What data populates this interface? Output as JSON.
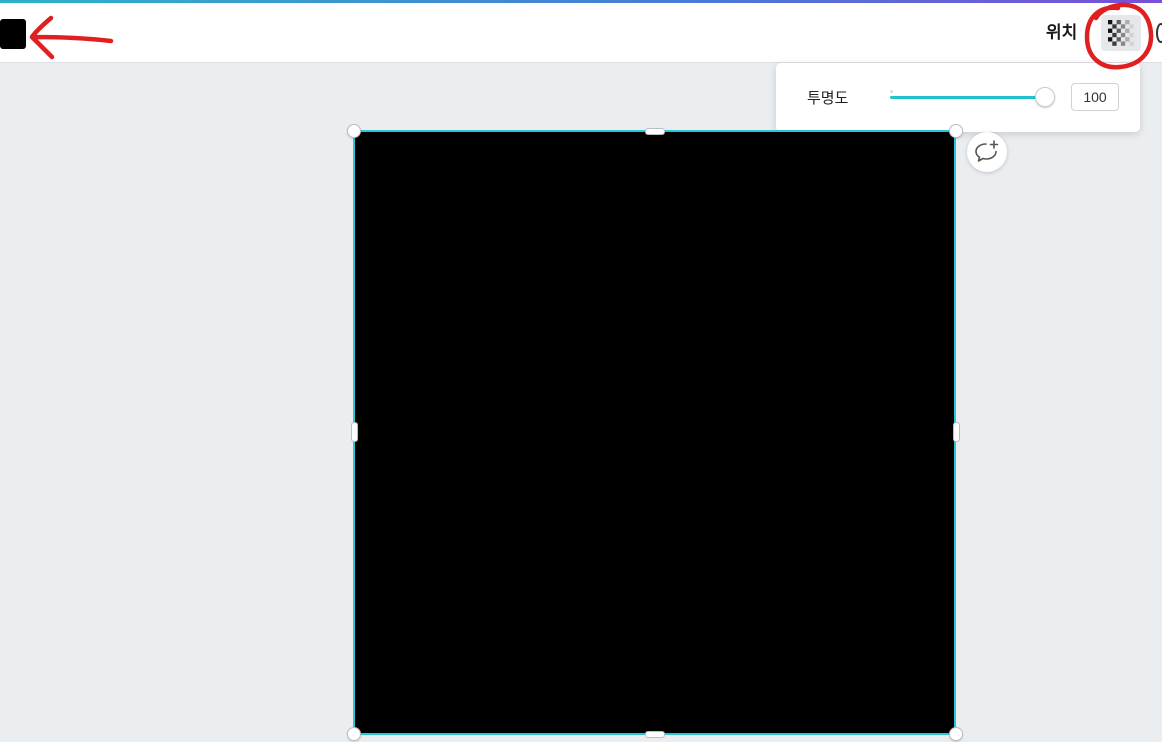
{
  "toolbar": {
    "color_swatch": "#000000",
    "position_label": "위치",
    "transparency_icon": "checkerboard-transparency-icon"
  },
  "popover": {
    "label": "투명도",
    "value": "100",
    "slider_level_percent": 100
  },
  "canvas": {
    "element_fill": "#000000",
    "selection_color": "#2ec4d6",
    "comment_icon": "add-comment-icon"
  },
  "annotations": {
    "arrow_color": "#e02020",
    "circle_color": "#e02020"
  }
}
